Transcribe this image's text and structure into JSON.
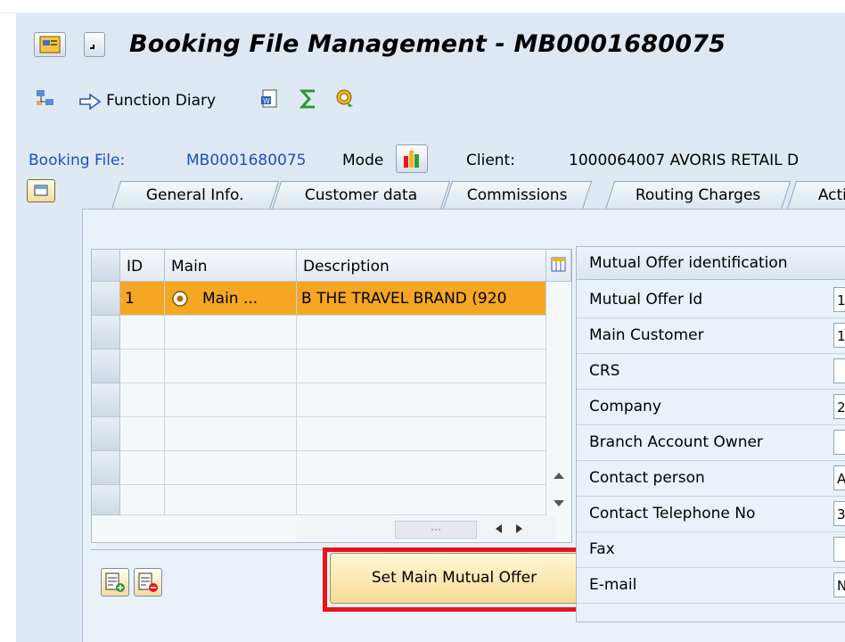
{
  "window": {
    "title": "Booking File Management - MB0001680075"
  },
  "toolbar": {
    "function_diary_label": "Function Diary"
  },
  "header": {
    "booking_file_label": "Booking File:",
    "booking_file_value": "MB0001680075",
    "mode_label": "Mode",
    "client_label": "Client:",
    "client_value": "1000064007  AVORIS RETAIL D"
  },
  "tabs": [
    {
      "label": "General Info."
    },
    {
      "label": "Customer data"
    },
    {
      "label": "Commissions"
    },
    {
      "label": "Routing Charges"
    },
    {
      "label": "Acti"
    }
  ],
  "grid": {
    "columns": [
      "ID",
      "Main",
      "Description"
    ],
    "rows": [
      {
        "id": "1",
        "main": "Main ...",
        "description": "B THE TRAVEL BRAND (920"
      }
    ]
  },
  "details": {
    "section_title": "Mutual Offer identification",
    "fields": [
      {
        "label": "Mutual Offer Id",
        "value": "1"
      },
      {
        "label": "Main Customer",
        "value": "1"
      },
      {
        "label": "CRS",
        "value": ""
      },
      {
        "label": "Company",
        "value": "2"
      },
      {
        "label": "Branch Account Owner",
        "value": ""
      },
      {
        "label": "Contact person",
        "value": "A"
      },
      {
        "label": "Contact Telephone No",
        "value": "3"
      },
      {
        "label": "Fax",
        "value": ""
      },
      {
        "label": "E-mail",
        "value": "N"
      }
    ]
  },
  "actions": {
    "set_main_label": "Set Main Mutual Offer"
  },
  "colors": {
    "highlight_row": "#f5a623",
    "accent_red": "#e8141c",
    "link_blue": "#1a4fc4"
  }
}
